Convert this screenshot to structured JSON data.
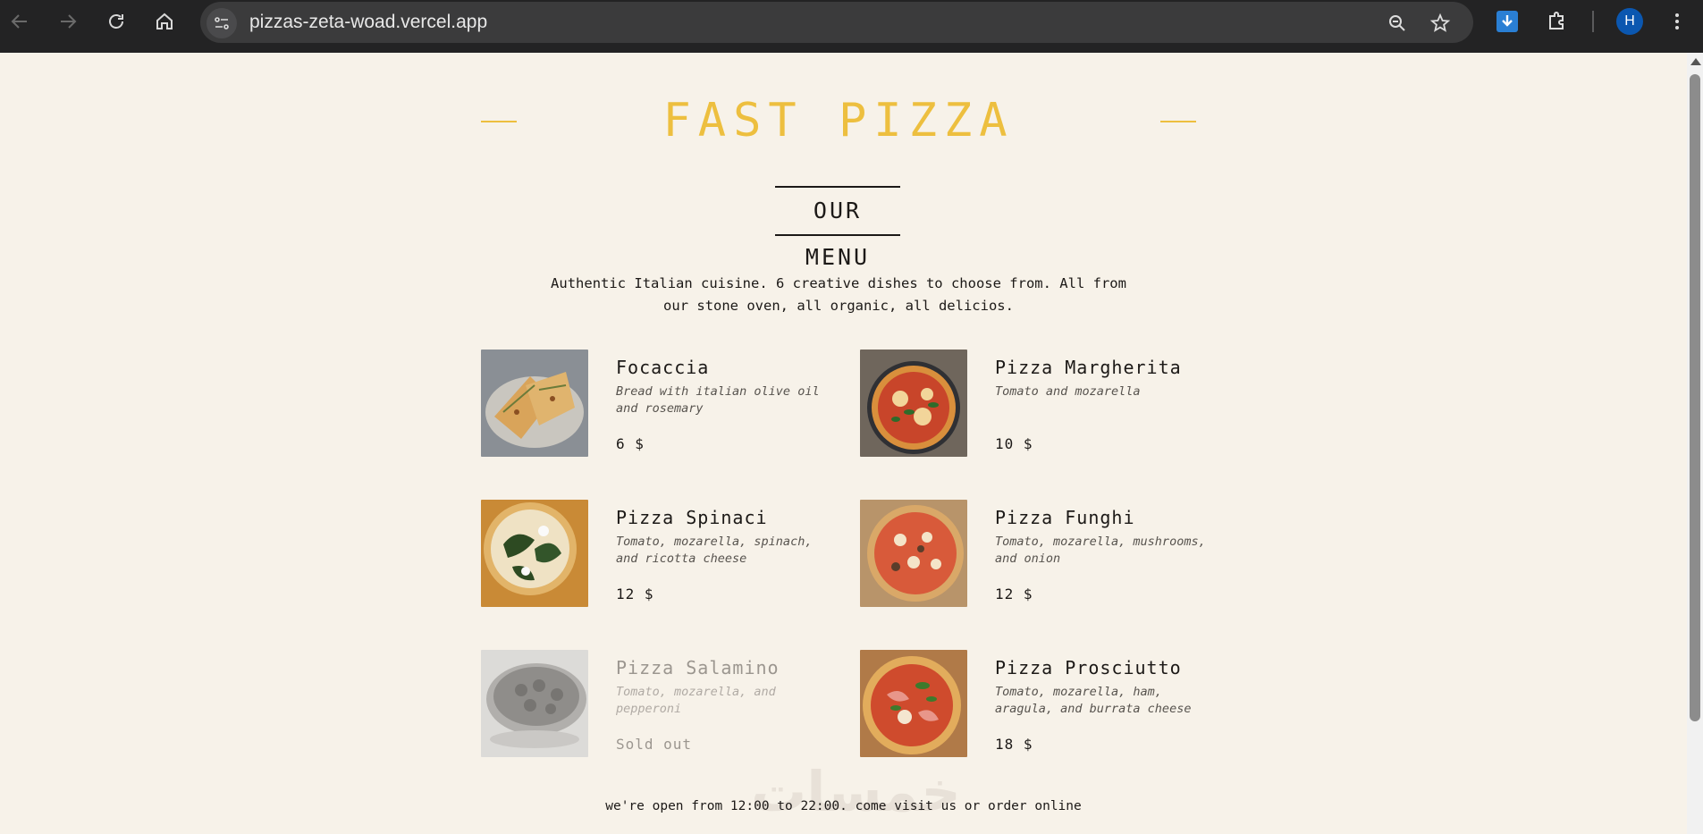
{
  "browser": {
    "url": "pizzas-zeta-woad.vercel.app",
    "avatar_letter": "H",
    "icons": [
      "back-icon",
      "forward-icon",
      "reload-icon",
      "home-icon",
      "site-info-icon",
      "zoom-icon",
      "star-icon",
      "download-icon",
      "extensions-icon",
      "menu-icon"
    ]
  },
  "header": {
    "title": "FAST PIZZA"
  },
  "menu": {
    "title": "OUR MENU",
    "intro": "Authentic Italian cuisine. 6 creative dishes to choose from. All from our stone oven, all organic, all delicios.",
    "items": [
      {
        "name": "Focaccia",
        "ingredients": "Bread with italian olive oil and rosemary",
        "price": "6 $",
        "sold_out": false,
        "image": "focaccia-photo"
      },
      {
        "name": "Pizza Margherita",
        "ingredients": "Tomato and mozarella",
        "price": "10 $",
        "sold_out": false,
        "image": "margherita-photo"
      },
      {
        "name": "Pizza Spinaci",
        "ingredients": "Tomato, mozarella, spinach, and ricotta cheese",
        "price": "12 $",
        "sold_out": false,
        "image": "spinaci-photo"
      },
      {
        "name": "Pizza Funghi",
        "ingredients": "Tomato, mozarella, mushrooms, and onion",
        "price": "12 $",
        "sold_out": false,
        "image": "funghi-photo"
      },
      {
        "name": "Pizza Salamino",
        "ingredients": "Tomato, mozarella, and pepperoni",
        "price": "Sold out",
        "sold_out": true,
        "image": "salamino-photo"
      },
      {
        "name": "Pizza Prosciutto",
        "ingredients": "Tomato, mozarella, ham, aragula, and burrata cheese",
        "price": "18 $",
        "sold_out": false,
        "image": "prosciutto-photo"
      }
    ]
  },
  "footer": {
    "text": "we're open from 12:00 to 22:00. come visit us or order online"
  },
  "colors": {
    "accent": "#edbf3f",
    "background": "#f7f2e9",
    "text": "#1c1917"
  }
}
